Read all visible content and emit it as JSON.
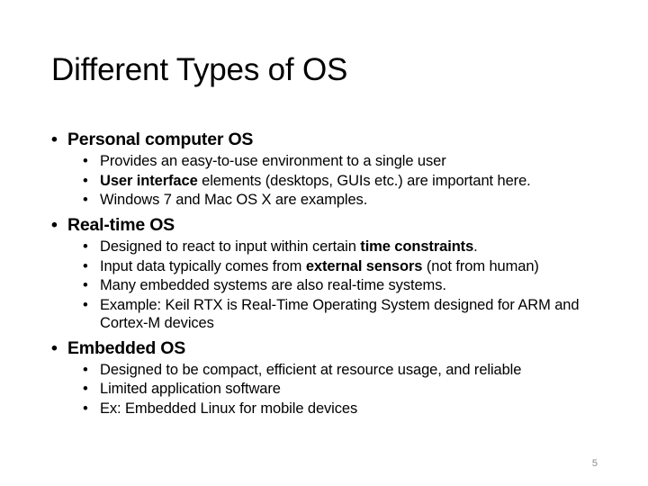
{
  "slide": {
    "title": "Different Types of OS",
    "page_number": "5",
    "bullet_char": "•",
    "sections": [
      {
        "heading": "Personal computer OS",
        "items": [
          {
            "pre": "Provides an easy-to-use environment to a single user",
            "bold": "",
            "post": ""
          },
          {
            "pre": "",
            "bold": "User interface",
            "post": " elements (desktops, GUIs etc.) are important here."
          },
          {
            "pre": "Windows 7 and Mac OS X are examples.",
            "bold": "",
            "post": ""
          }
        ]
      },
      {
        "heading": "Real-time OS",
        "items": [
          {
            "pre": "Designed to react to input within certain ",
            "bold": "time constraints",
            "post": "."
          },
          {
            "pre": "Input data typically comes from ",
            "bold": "external sensors",
            "post": " (not from human)"
          },
          {
            "pre": "Many embedded systems are also real-time systems.",
            "bold": "",
            "post": ""
          },
          {
            "pre": "Example: Keil RTX is  Real-Time Operating System designed for ARM and Cortex-M devices",
            "bold": "",
            "post": ""
          }
        ]
      },
      {
        "heading": "Embedded OS",
        "items": [
          {
            "pre": "Designed to be compact, efficient at resource usage, and reliable",
            "bold": "",
            "post": ""
          },
          {
            "pre": "Limited application software",
            "bold": "",
            "post": ""
          },
          {
            "pre": "Ex: Embedded Linux for mobile devices",
            "bold": "",
            "post": ""
          }
        ]
      }
    ]
  }
}
